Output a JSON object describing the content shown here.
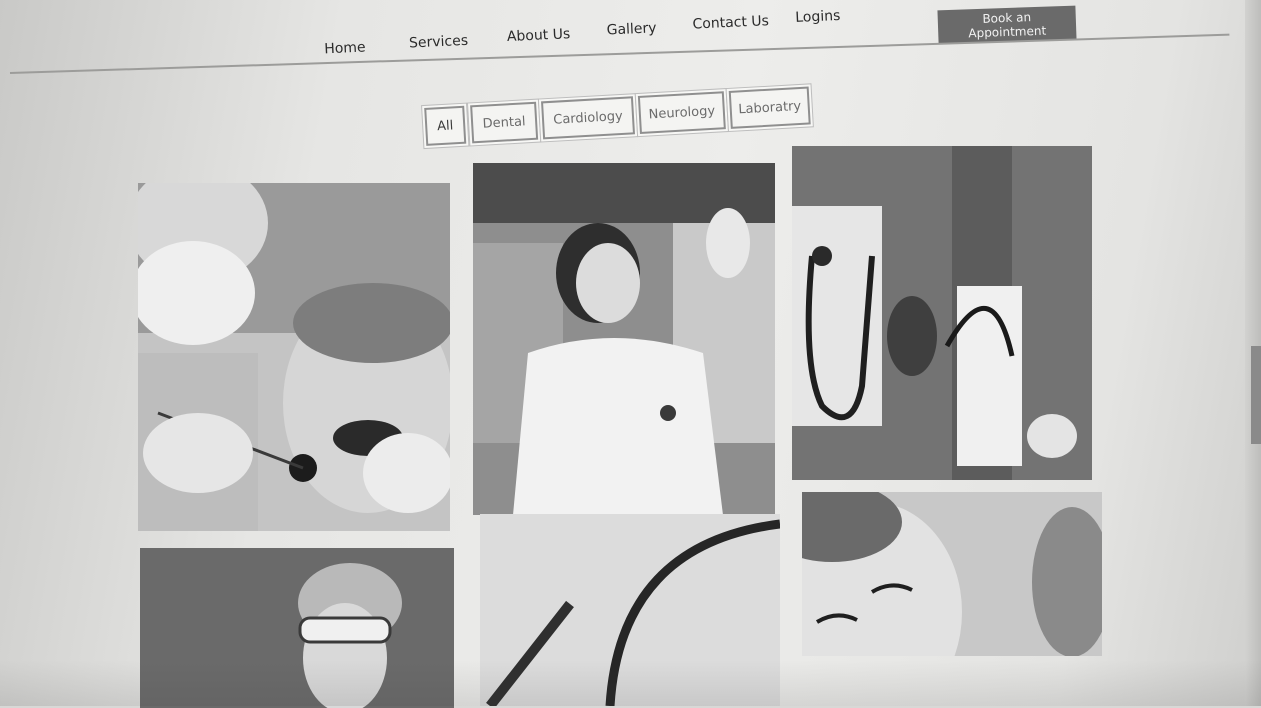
{
  "nav": {
    "items": [
      "Home",
      "Services",
      "About Us",
      "Gallery",
      "Contact Us",
      "Logins"
    ],
    "cta_label": "Book an Appointment"
  },
  "filters": {
    "items": [
      "All",
      "Dental",
      "Cardiology",
      "Neurology",
      "Laboratry"
    ],
    "active": "All"
  },
  "gallery": {
    "photos": [
      {
        "subject": "dental-exam-photo"
      },
      {
        "subject": "doctor-xray-photo"
      },
      {
        "subject": "stethoscope-blood-pressure-photo"
      },
      {
        "subject": "lab-technician-photo"
      },
      {
        "subject": "stethoscope-pen-photo"
      },
      {
        "subject": "smiling-patient-photo"
      }
    ]
  }
}
